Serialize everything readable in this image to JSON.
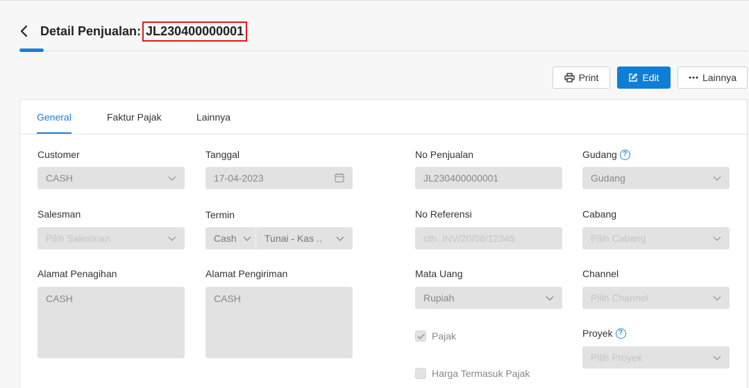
{
  "header": {
    "title": "Detail Penjualan:",
    "doc_number": "JL230400000001"
  },
  "toolbar": {
    "print_label": "Print",
    "edit_label": "Edit",
    "more_label": "Lainnya"
  },
  "tabs": [
    {
      "label": "General",
      "active": true
    },
    {
      "label": "Faktur Pajak",
      "active": false
    },
    {
      "label": "Lainnya",
      "active": false
    }
  ],
  "form": {
    "customer": {
      "label": "Customer",
      "value": "CASH"
    },
    "tanggal": {
      "label": "Tanggal",
      "value": "17-04-2023"
    },
    "no_penjualan": {
      "label": "No Penjualan",
      "value": "JL230400000001"
    },
    "gudang": {
      "label": "Gudang",
      "value": "Gudang"
    },
    "salesman": {
      "label": "Salesman",
      "placeholder": "Pilih Salesman"
    },
    "termin": {
      "label": "Termin",
      "value": "Cash",
      "value2": "Tunai - Kas .."
    },
    "no_referensi": {
      "label": "No Referensi",
      "placeholder": "cth. INV/20/08/12345"
    },
    "cabang": {
      "label": "Cabang",
      "placeholder": "Pilih Cabang"
    },
    "alamat_penagihan": {
      "label": "Alamat Penagihan",
      "value": "CASH"
    },
    "alamat_pengiriman": {
      "label": "Alamat Pengiriman",
      "value": "CASH"
    },
    "mata_uang": {
      "label": "Mata Uang",
      "value": "Rupiah"
    },
    "channel": {
      "label": "Channel",
      "placeholder": "Pilih Channel"
    },
    "pajak": {
      "label": "Pajak",
      "checked": true
    },
    "harga_termasuk_pajak": {
      "label": "Harga Termasuk Pajak",
      "checked": false
    },
    "proyek": {
      "label": "Proyek",
      "placeholder": "Pilih Proyek"
    }
  },
  "colors": {
    "accent": "#1a7fd8",
    "highlight_box": "#e01818",
    "field_bg": "#e2e2e2"
  }
}
